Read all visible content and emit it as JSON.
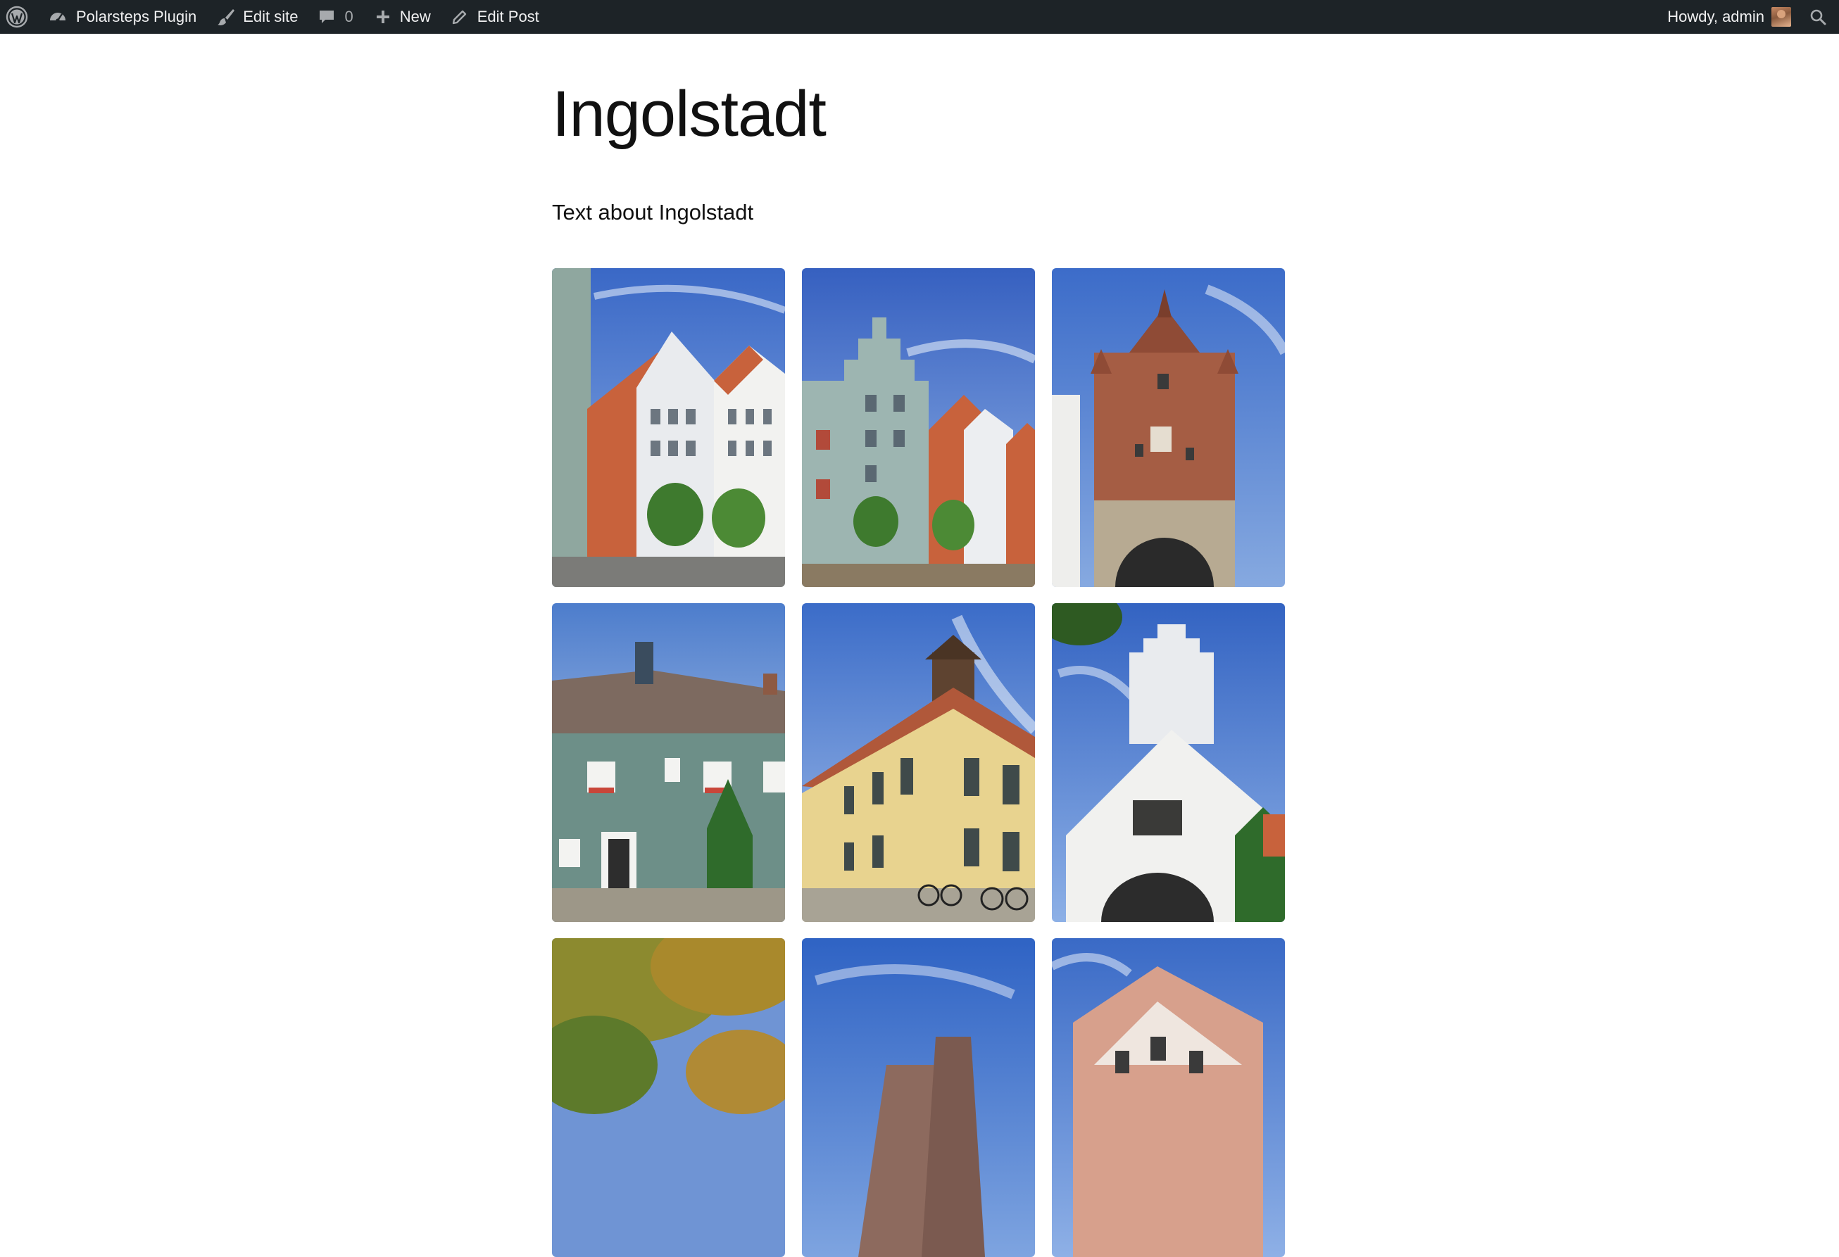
{
  "adminbar": {
    "wp_logo": "wordpress-icon",
    "site_name": "Polarsteps Plugin",
    "edit_site": "Edit site",
    "comments_count": "0",
    "new_label": "New",
    "edit_post": "Edit Post",
    "howdy": "Howdy, admin"
  },
  "post": {
    "title": "Ingolstadt",
    "body_text": "Text about Ingolstadt"
  },
  "gallery": {
    "photos": [
      {
        "subject": "gabled-townhouses-photo"
      },
      {
        "subject": "blue-stepped-gable-house-photo"
      },
      {
        "subject": "brick-gate-tower-photo"
      },
      {
        "subject": "green-house-with-dormers-photo"
      },
      {
        "subject": "yellow-palace-with-bicycles-photo"
      },
      {
        "subject": "white-stepped-gable-tower-photo"
      },
      {
        "subject": "autumn-trees-photo"
      },
      {
        "subject": "church-towers-photo"
      },
      {
        "subject": "baroque-facade-photo"
      }
    ]
  },
  "colors": {
    "adminbar_bg": "#1d2327",
    "adminbar_text": "#f0f0f1",
    "sky": "#3f72c8"
  }
}
